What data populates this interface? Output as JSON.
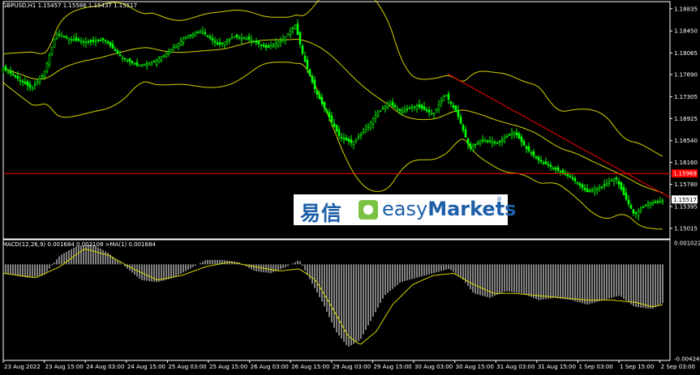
{
  "header": {
    "symbol_line": "GBPUSD,H1  1.15457 1.15586 1.15437 1.15517",
    "macd_line": "MACD(12,26,9) 0.001684 0.002108 >MA(1) 0.001684"
  },
  "logo": {
    "chinese": "易信",
    "brand_light": "easy",
    "brand_bold": "Markets",
    "reg": "®"
  },
  "colors": {
    "background": "#000000",
    "candle": "#00ff00",
    "bands": "#d4d400",
    "trendline": "#ff0000",
    "level": "#ff0000",
    "macd_hist": "#ffffff",
    "signal": "#d4d400"
  },
  "chart_data": [
    {
      "type": "candlestick",
      "title": "GBPUSD,H1",
      "ohlc_last": {
        "open": 1.15457,
        "high": 1.15586,
        "low": 1.15437,
        "close": 1.15517
      },
      "y_ticks": [
        "1.18835",
        "1.18450",
        "1.18065",
        "1.17690",
        "1.17305",
        "1.16925",
        "1.16540",
        "1.16160",
        "1.15780",
        "1.15395",
        "1.15015"
      ],
      "ylim": [
        1.1483,
        1.1896
      ],
      "x_ticks": [
        "23 Aug 2022",
        "23 Aug 15:00",
        "24 Aug 03:00",
        "24 Aug 15:00",
        "25 Aug 03:00",
        "25 Aug 15:00",
        "26 Aug 03:00",
        "26 Aug 15:00",
        "29 Aug 03:00",
        "29 Aug 15:00",
        "30 Aug 03:00",
        "30 Aug 15:00",
        "31 Aug 03:00",
        "31 Aug 15:00",
        "1 Sep 03:00",
        "1 Sep 15:00",
        "2 Sep 03:00"
      ],
      "price_label": "1.15517",
      "level_label": "1.15969",
      "level": 1.15969,
      "close_path": [
        {
          "x": 0,
          "y": 1.178
        },
        {
          "x": 20,
          "y": 1.176
        },
        {
          "x": 35,
          "y": 1.1745
        },
        {
          "x": 50,
          "y": 1.177
        },
        {
          "x": 65,
          "y": 1.184
        },
        {
          "x": 85,
          "y": 1.183
        },
        {
          "x": 105,
          "y": 1.1825
        },
        {
          "x": 125,
          "y": 1.183
        },
        {
          "x": 145,
          "y": 1.18
        },
        {
          "x": 165,
          "y": 1.1785
        },
        {
          "x": 185,
          "y": 1.179
        },
        {
          "x": 205,
          "y": 1.181
        },
        {
          "x": 225,
          "y": 1.1835
        },
        {
          "x": 245,
          "y": 1.1845
        },
        {
          "x": 265,
          "y": 1.182
        },
        {
          "x": 285,
          "y": 1.1835
        },
        {
          "x": 305,
          "y": 1.183
        },
        {
          "x": 325,
          "y": 1.1815
        },
        {
          "x": 345,
          "y": 1.183
        },
        {
          "x": 360,
          "y": 1.1855
        },
        {
          "x": 370,
          "y": 1.18
        },
        {
          "x": 385,
          "y": 1.174
        },
        {
          "x": 400,
          "y": 1.17
        },
        {
          "x": 415,
          "y": 1.166
        },
        {
          "x": 430,
          "y": 1.165
        },
        {
          "x": 445,
          "y": 1.167
        },
        {
          "x": 460,
          "y": 1.17
        },
        {
          "x": 475,
          "y": 1.172
        },
        {
          "x": 490,
          "y": 1.1705
        },
        {
          "x": 510,
          "y": 1.1715
        },
        {
          "x": 530,
          "y": 1.17
        },
        {
          "x": 545,
          "y": 1.1735
        },
        {
          "x": 560,
          "y": 1.17
        },
        {
          "x": 575,
          "y": 1.164
        },
        {
          "x": 590,
          "y": 1.1655
        },
        {
          "x": 610,
          "y": 1.165
        },
        {
          "x": 630,
          "y": 1.167
        },
        {
          "x": 645,
          "y": 1.164
        },
        {
          "x": 660,
          "y": 1.162
        },
        {
          "x": 680,
          "y": 1.1605
        },
        {
          "x": 700,
          "y": 1.159
        },
        {
          "x": 720,
          "y": 1.1565
        },
        {
          "x": 740,
          "y": 1.1575
        },
        {
          "x": 755,
          "y": 1.159
        },
        {
          "x": 765,
          "y": 1.156
        },
        {
          "x": 778,
          "y": 1.1525
        },
        {
          "x": 795,
          "y": 1.1545
        },
        {
          "x": 815,
          "y": 1.155
        }
      ],
      "trendline": {
        "from": {
          "x": 548,
          "y": 1.177
        },
        "to": {
          "x": 822,
          "y": 1.1555
        }
      }
    },
    {
      "type": "bar",
      "title": "MACD(12,26,9)",
      "y_ticks": [
        "0.001022",
        "-0.004246"
      ],
      "ylim": [
        -0.0043,
        0.0011
      ],
      "histogram": [
        {
          "x": 0,
          "y": -0.0004
        },
        {
          "x": 30,
          "y": -0.0006
        },
        {
          "x": 50,
          "y": -0.0005
        },
        {
          "x": 70,
          "y": 0.0004
        },
        {
          "x": 90,
          "y": 0.0008
        },
        {
          "x": 110,
          "y": 0.0009
        },
        {
          "x": 130,
          "y": 0.0005
        },
        {
          "x": 150,
          "y": -0.0001
        },
        {
          "x": 170,
          "y": -0.0007
        },
        {
          "x": 190,
          "y": -0.0008
        },
        {
          "x": 210,
          "y": -0.0006
        },
        {
          "x": 230,
          "y": -0.0002
        },
        {
          "x": 250,
          "y": 0.0002
        },
        {
          "x": 270,
          "y": 0.0002
        },
        {
          "x": 290,
          "y": 0.0001
        },
        {
          "x": 310,
          "y": -0.0003
        },
        {
          "x": 330,
          "y": -0.0004
        },
        {
          "x": 350,
          "y": -0.0001
        },
        {
          "x": 365,
          "y": 0.0002
        },
        {
          "x": 380,
          "y": -0.0008
        },
        {
          "x": 395,
          "y": -0.0018
        },
        {
          "x": 410,
          "y": -0.003
        },
        {
          "x": 425,
          "y": -0.0037
        },
        {
          "x": 440,
          "y": -0.0034
        },
        {
          "x": 455,
          "y": -0.0024
        },
        {
          "x": 470,
          "y": -0.0014
        },
        {
          "x": 490,
          "y": -0.0008
        },
        {
          "x": 510,
          "y": -0.0006
        },
        {
          "x": 530,
          "y": -0.0004
        },
        {
          "x": 550,
          "y": -0.0002
        },
        {
          "x": 565,
          "y": -0.0006
        },
        {
          "x": 580,
          "y": -0.0013
        },
        {
          "x": 600,
          "y": -0.0015
        },
        {
          "x": 620,
          "y": -0.0012
        },
        {
          "x": 640,
          "y": -0.0013
        },
        {
          "x": 660,
          "y": -0.0016
        },
        {
          "x": 680,
          "y": -0.0015
        },
        {
          "x": 700,
          "y": -0.0016
        },
        {
          "x": 720,
          "y": -0.0018
        },
        {
          "x": 740,
          "y": -0.0016
        },
        {
          "x": 760,
          "y": -0.0014
        },
        {
          "x": 778,
          "y": -0.0019
        },
        {
          "x": 800,
          "y": -0.002
        },
        {
          "x": 815,
          "y": -0.0017
        }
      ],
      "signal": [
        {
          "x": 0,
          "y": -0.0004
        },
        {
          "x": 40,
          "y": -0.0006
        },
        {
          "x": 70,
          "y": -0.0001
        },
        {
          "x": 100,
          "y": 0.0007
        },
        {
          "x": 130,
          "y": 0.0004
        },
        {
          "x": 160,
          "y": -0.0002
        },
        {
          "x": 190,
          "y": -0.0007
        },
        {
          "x": 220,
          "y": -0.0005
        },
        {
          "x": 250,
          "y": -0.0001
        },
        {
          "x": 280,
          "y": 0.0001
        },
        {
          "x": 310,
          "y": -0.0001
        },
        {
          "x": 340,
          "y": -0.0003
        },
        {
          "x": 365,
          "y": -0.0002
        },
        {
          "x": 385,
          "y": -0.0007
        },
        {
          "x": 405,
          "y": -0.0019
        },
        {
          "x": 425,
          "y": -0.0032
        },
        {
          "x": 440,
          "y": -0.0036
        },
        {
          "x": 460,
          "y": -0.003
        },
        {
          "x": 480,
          "y": -0.0018
        },
        {
          "x": 505,
          "y": -0.0009
        },
        {
          "x": 530,
          "y": -0.0005
        },
        {
          "x": 555,
          "y": -0.0004
        },
        {
          "x": 580,
          "y": -0.0009
        },
        {
          "x": 605,
          "y": -0.0013
        },
        {
          "x": 630,
          "y": -0.0013
        },
        {
          "x": 660,
          "y": -0.0014
        },
        {
          "x": 690,
          "y": -0.0015
        },
        {
          "x": 720,
          "y": -0.0016
        },
        {
          "x": 750,
          "y": -0.0016
        },
        {
          "x": 780,
          "y": -0.0017
        },
        {
          "x": 800,
          "y": -0.0019
        },
        {
          "x": 815,
          "y": -0.0018
        }
      ]
    }
  ]
}
